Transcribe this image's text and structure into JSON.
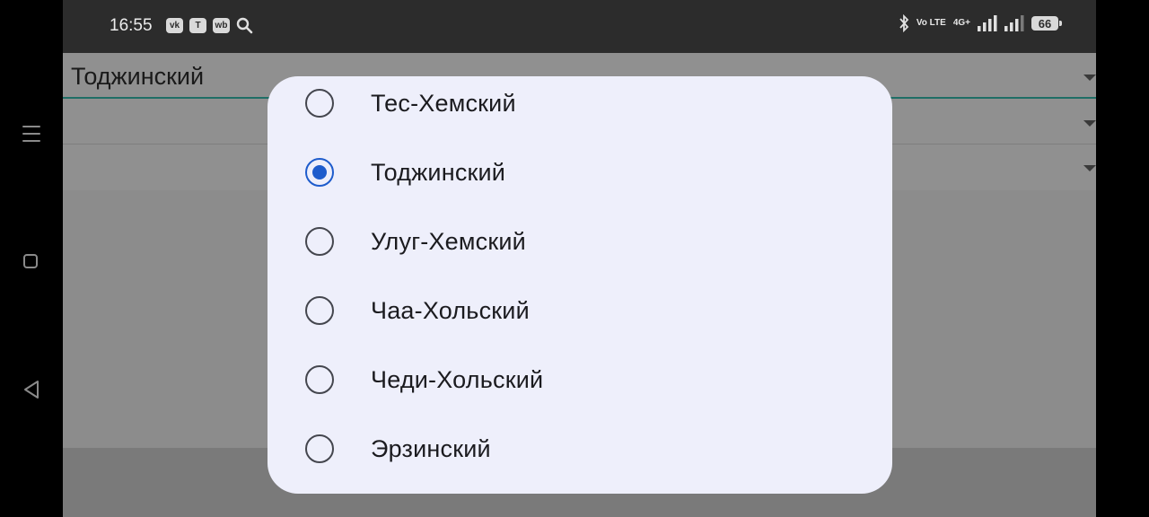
{
  "status_bar": {
    "time": "16:55",
    "app_icons": [
      "vk-icon",
      "tutu-icon",
      "wildberries-icon",
      "search-icon"
    ],
    "app_labels": [
      "vk",
      "T",
      "wb"
    ],
    "network": "Vo LTE",
    "network_2": "4G+",
    "battery": "66"
  },
  "nav": {
    "buttons": [
      "menu-icon",
      "home-icon",
      "back-icon"
    ]
  },
  "spinners": [
    {
      "value": "Тоджинский"
    },
    {
      "value": ""
    },
    {
      "value": ""
    }
  ],
  "dialog": {
    "selected_index": 1,
    "options": [
      {
        "label": "Тес-Хемский",
        "checked": false
      },
      {
        "label": "Тоджинский",
        "checked": true
      },
      {
        "label": "Улуг-Хемский",
        "checked": false
      },
      {
        "label": "Чаа-Хольский",
        "checked": false
      },
      {
        "label": "Чеди-Хольский",
        "checked": false
      },
      {
        "label": "Эрзинский",
        "checked": false
      }
    ]
  },
  "colors": {
    "accent": "#1e5ccc",
    "dialog_bg": "#eeeffb",
    "underline": "#1f6e66"
  }
}
